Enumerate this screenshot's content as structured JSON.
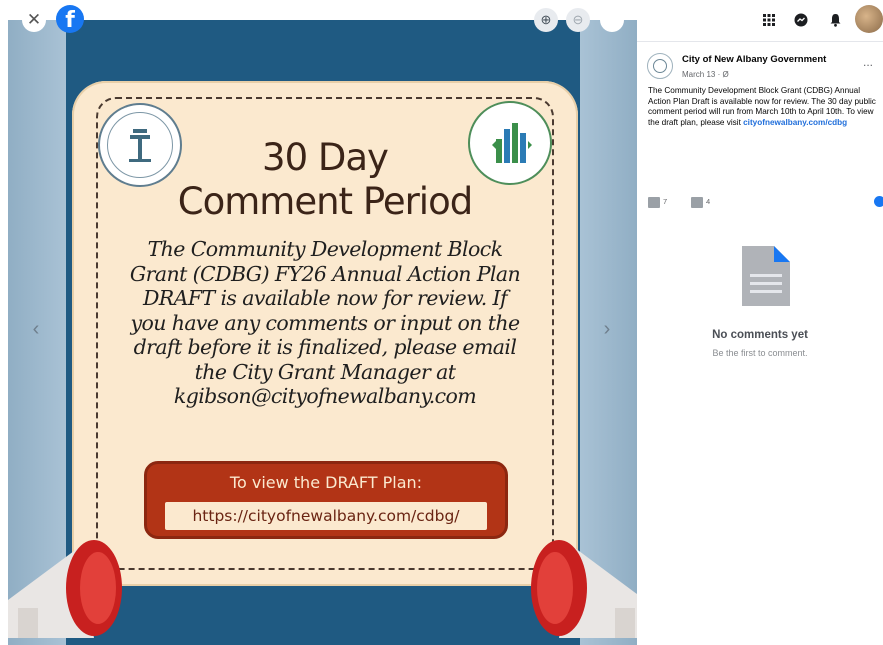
{
  "viewer": {
    "close_glyph": "✕",
    "facebook_logo_letter": "f",
    "prev_glyph": "‹",
    "next_glyph": "›",
    "zoom_in_glyph": "⊕",
    "zoom_out_glyph": "⊖"
  },
  "poster": {
    "title_line1": "30 Day",
    "title_line2": "Comment Period",
    "body": "The Community Development Block Grant (CDBG) FY26 Annual Action Plan DRAFT is available now for review. If you have any comments or input on the draft before it is finalized, please email the City Grant Manager at kgibson@cityofnewalbany.com",
    "cta_label": "To view the DRAFT Plan:",
    "cta_url": "https://cityofnewalbany.com/cdbg/",
    "colors": {
      "background": "#1f5a82",
      "card": "#fbe9cf",
      "cta": "#b23416",
      "title": "#3b2418"
    }
  },
  "topbar": {
    "icons": [
      "grid-icon",
      "messenger-icon",
      "bell-icon",
      "avatar"
    ]
  },
  "post": {
    "page_name": "City of New Albany Government",
    "date": "March 13 · Ø",
    "more_glyph": "...",
    "text": "The Community Development Block Grant (CDBG) Annual Action Plan Draft is available now for review. The 30 day public comment period will run from March 10th to April 10th. To view the draft plan, please visit ",
    "link": "cityofnewalbany.com/cdbg",
    "reactions_count": "7",
    "comments_count": "4"
  },
  "comments": {
    "empty_title": "No comments yet",
    "empty_subtitle": "Be the first to comment."
  }
}
